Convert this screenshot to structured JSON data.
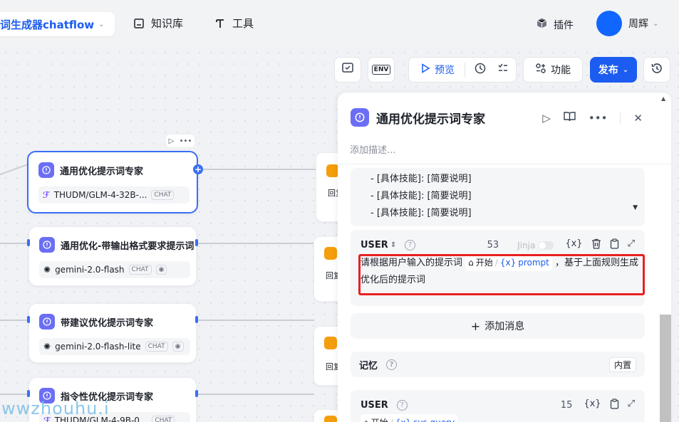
{
  "header": {
    "app_title": "词生成器chatflow",
    "nav": [
      {
        "label": "知识库",
        "icon": "book-icon"
      },
      {
        "label": "工具",
        "icon": "tool-icon"
      }
    ],
    "plugin_label": "插件",
    "user_name": "周辉"
  },
  "toolbar": {
    "env_label": "ENV",
    "preview_label": "预览",
    "features_label": "功能",
    "publish_label": "发布"
  },
  "nodes": [
    {
      "title": "通用优化提示词专家",
      "model": "THUDM/GLM-4-32B-...",
      "badge": "CHAT"
    },
    {
      "title": "通用优化-带输出格式要求提示词",
      "model": "gemini-2.0-flash",
      "badge": "CHAT"
    },
    {
      "title": "带建议优化提示词专家",
      "model": "gemini-2.0-flash-lite",
      "badge": "CHAT"
    },
    {
      "title": "指令性优化提示词专家",
      "model": "THUDM/GLM-4-9B-0...",
      "badge": "CHAT"
    }
  ],
  "mini_label": "回复",
  "panel": {
    "title": "通用优化提示词专家",
    "description_placeholder": "添加描述...",
    "skills": [
      "- [具体技能]: [简要说明]",
      "- [具体技能]: [简要说明]",
      "- [具体技能]: [简要说明]"
    ],
    "message": {
      "role": "USER",
      "count": "53",
      "jinja_label": "Jinja",
      "text_before": "请根据用户输入的提示词",
      "var_node": "开始",
      "var_name": "prompt",
      "text_after": "，基于上面规则生成优化后的提示词"
    },
    "add_message_label": "添加消息",
    "memory_label": "记忆",
    "memory_tag": "内置",
    "message2": {
      "role": "USER",
      "count": "15",
      "var_node": "开始",
      "var_name": "sys.query"
    }
  },
  "watermark": "wwzhouhu.i"
}
